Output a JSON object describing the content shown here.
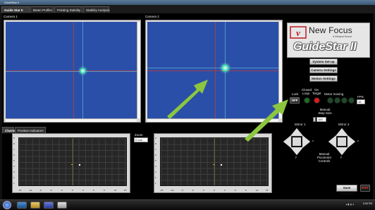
{
  "window": {
    "title": "GuideStar II"
  },
  "tabs": [
    "Guide Star II",
    "Beam Profiler",
    "Pointing Stability",
    "Stability Analysis"
  ],
  "camera1": {
    "label": "Camera 1"
  },
  "camera2": {
    "label": "Camera 2"
  },
  "lower_tabs": [
    "Charts",
    "Position Indicators"
  ],
  "zoom": {
    "label": "Zoom",
    "value": "0 mm"
  },
  "logo": {
    "brand": "New Focus",
    "tagline": "A Newport Brand",
    "product": "GuideStar II"
  },
  "buttons": {
    "system_setup": "System Set-up",
    "camera_settings": "Camera Settings",
    "motion_settings": "Motion Settings",
    "save_settings": "Save Settings",
    "exit": "EXIT"
  },
  "controls": {
    "lock_label": "Lock",
    "lock_state": "OFF",
    "closed_loop_label": "Closed Loop",
    "on_target_label": "On Target",
    "motor_moving_label": "Motor moving",
    "fps_label": "FPS",
    "fps_value": "15",
    "step_size_label": "Manual Step Size",
    "step_size_value": "100"
  },
  "mirrors": {
    "mirror1": "Mirror 1",
    "mirror2": "Mirror 2",
    "picomotor_label": "Manual Picomotor Controls",
    "x": "x",
    "y": "y"
  },
  "plots": {
    "y_ticks": [
      "9",
      "8",
      "7",
      "6",
      "5",
      "4",
      "3",
      "2",
      "1",
      "0"
    ],
    "x_ticks": [
      "-15",
      "-12",
      "-9",
      "-6",
      "-3",
      "0",
      "3",
      "6",
      "9",
      "12",
      "15"
    ]
  },
  "colors": {
    "camera_field": "#2a4fa8",
    "led_green": "#1f6a2a",
    "led_red": "#e01a1a",
    "arrow": "#8cc63f"
  },
  "tray": {
    "time": "5:08 PM"
  }
}
